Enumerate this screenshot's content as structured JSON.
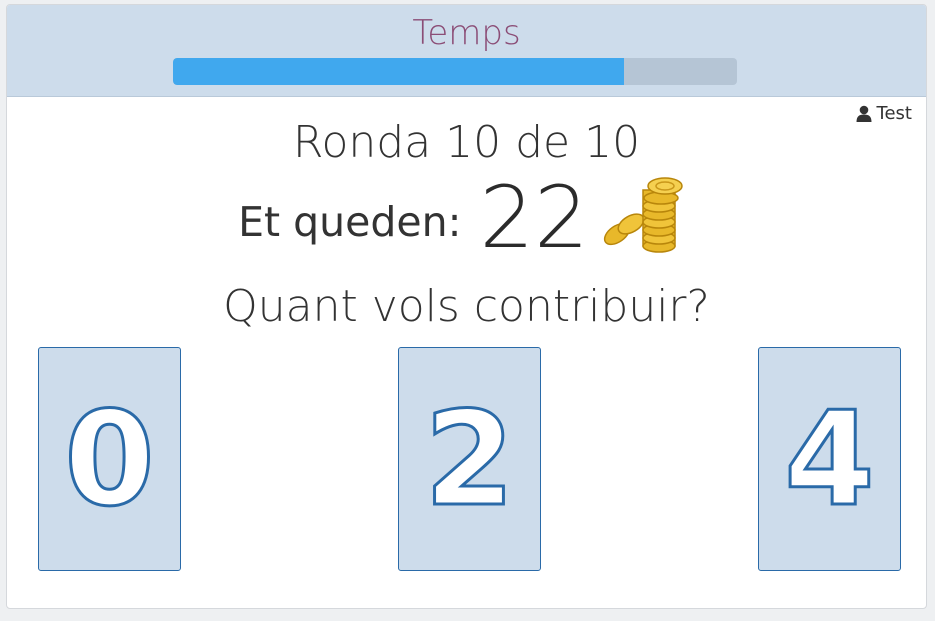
{
  "header": {
    "title": "Temps",
    "timer_progress_percent": 80
  },
  "user": {
    "name": "Test",
    "icon": "user-icon"
  },
  "round": {
    "label": "Ronda 10 de 10"
  },
  "remaining": {
    "label": "Et queden:",
    "value": "22",
    "icon": "coins-icon"
  },
  "question": {
    "text": "Quant vols contribuir?"
  },
  "options": [
    {
      "value": "0"
    },
    {
      "value": "2"
    },
    {
      "value": "4"
    }
  ],
  "colors": {
    "header_bg": "#cddceb",
    "title": "#8b4d76",
    "timer_fill": "#40a8ee",
    "timer_track": "#b5c5d5",
    "card_bg": "#cddceb",
    "card_border": "#2a6aa8"
  }
}
